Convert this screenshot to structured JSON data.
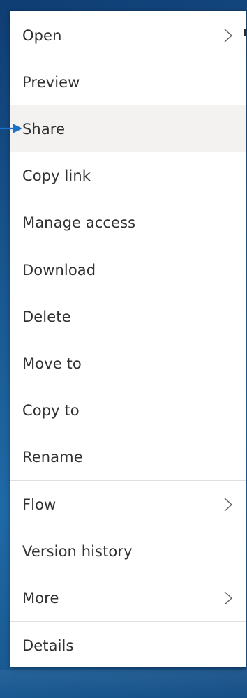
{
  "menu": {
    "groups": [
      {
        "items": [
          {
            "label": "Open",
            "submenu": true
          },
          {
            "label": "Preview",
            "submenu": false
          },
          {
            "label": "Share",
            "submenu": false,
            "hovered": true
          },
          {
            "label": "Copy link",
            "submenu": false
          },
          {
            "label": "Manage access",
            "submenu": false
          }
        ]
      },
      {
        "items": [
          {
            "label": "Download",
            "submenu": false
          },
          {
            "label": "Delete",
            "submenu": false
          },
          {
            "label": "Move to",
            "submenu": false
          },
          {
            "label": "Copy to",
            "submenu": false
          },
          {
            "label": "Rename",
            "submenu": false
          }
        ]
      },
      {
        "items": [
          {
            "label": "Flow",
            "submenu": true
          },
          {
            "label": "Version history",
            "submenu": false
          },
          {
            "label": "More",
            "submenu": true
          }
        ]
      },
      {
        "items": [
          {
            "label": "Details",
            "submenu": false
          }
        ]
      }
    ]
  },
  "colors": {
    "text": "#323130",
    "hover_bg": "#f3f2f1",
    "divider": "#e1dfdd",
    "pointer_arrow": "#1a73c9"
  },
  "icons": {
    "chevron": "chevron-right-icon",
    "pointer": "pointer-arrow-icon"
  }
}
